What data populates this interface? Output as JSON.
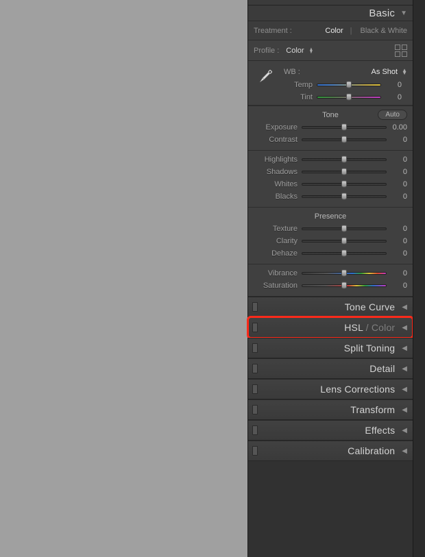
{
  "header": {
    "basic_title": "Basic"
  },
  "treatment": {
    "label": "Treatment :",
    "color": "Color",
    "bw": "Black & White"
  },
  "profile": {
    "label": "Profile :",
    "value": "Color"
  },
  "wb": {
    "label": "WB :",
    "value": "As Shot",
    "temp_label": "Temp",
    "temp_value": "0",
    "tint_label": "Tint",
    "tint_value": "0"
  },
  "tone": {
    "title": "Tone",
    "auto": "Auto",
    "exposure_label": "Exposure",
    "exposure_value": "0.00",
    "contrast_label": "Contrast",
    "contrast_value": "0",
    "highlights_label": "Highlights",
    "highlights_value": "0",
    "shadows_label": "Shadows",
    "shadows_value": "0",
    "whites_label": "Whites",
    "whites_value": "0",
    "blacks_label": "Blacks",
    "blacks_value": "0"
  },
  "presence": {
    "title": "Presence",
    "texture_label": "Texture",
    "texture_value": "0",
    "clarity_label": "Clarity",
    "clarity_value": "0",
    "dehaze_label": "Dehaze",
    "dehaze_value": "0",
    "vibrance_label": "Vibrance",
    "vibrance_value": "0",
    "saturation_label": "Saturation",
    "saturation_value": "0"
  },
  "panels": {
    "tone_curve": "Tone Curve",
    "hsl": "HSL",
    "hsl_suffix": " / Color",
    "split_toning": "Split Toning",
    "detail": "Detail",
    "lens_corrections": "Lens Corrections",
    "transform": "Transform",
    "effects": "Effects",
    "calibration": "Calibration"
  }
}
